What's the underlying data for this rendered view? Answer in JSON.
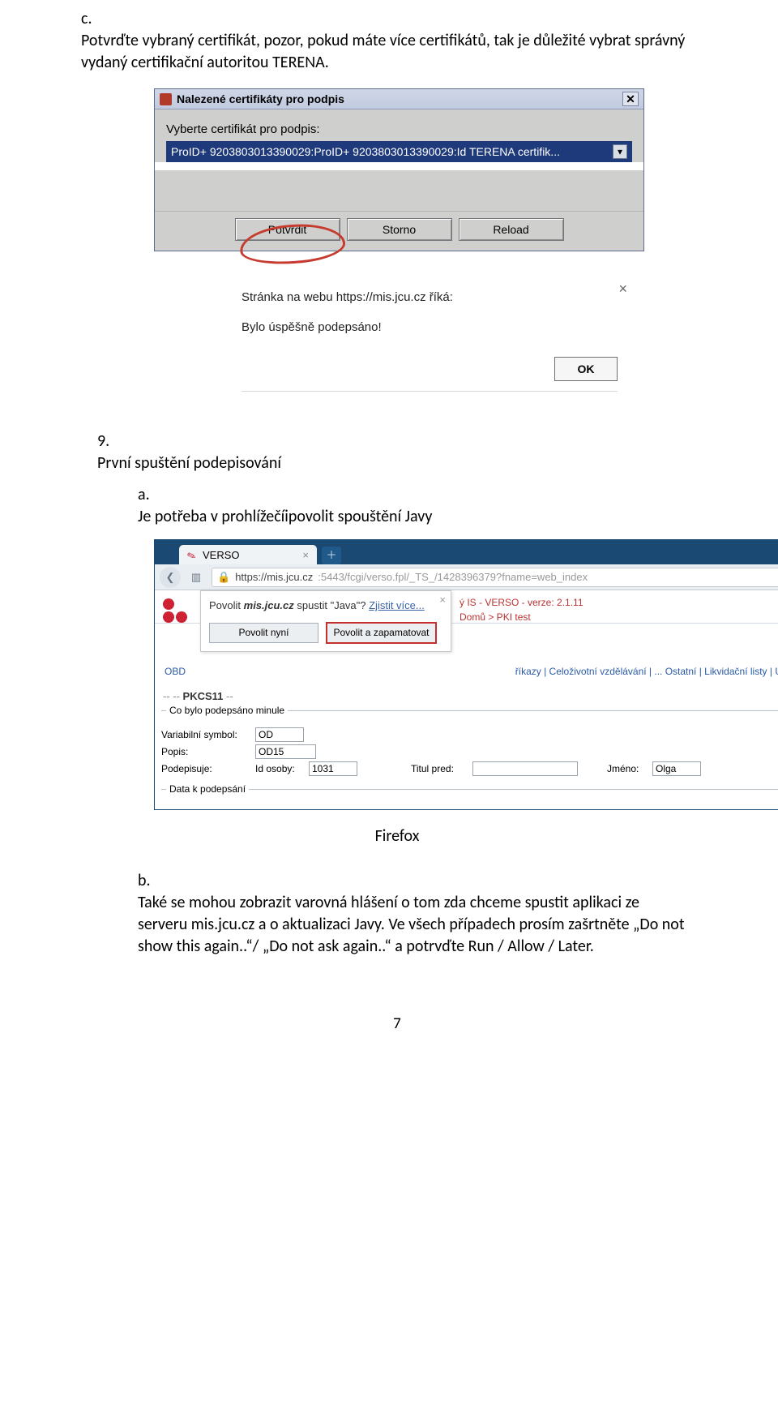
{
  "listC": {
    "marker": "c.",
    "text": "Potvrďte vybraný certifikát, pozor, pokud máte více certifikátů, tak je důležité vybrat správný vydaný certifikační autoritou TERENA."
  },
  "dlg1": {
    "title": "Nalezené certifikáty pro podpis",
    "label": "Vyberte certifikát pro podpis:",
    "selectText": "ProID+ 9203803013390029:ProID+ 9203803013390029:Id TERENA certifik...",
    "btns": {
      "confirm": "Potvrdit",
      "cancel": "Storno",
      "reload": "Reload"
    }
  },
  "dlg2": {
    "title": "Stránka na webu https://mis.jcu.cz říká:",
    "msg": "Bylo úspěšně podepsáno!",
    "ok": "OK"
  },
  "item9": {
    "marker": "9.",
    "text": "První spuštění podepisování"
  },
  "subA": {
    "marker": "a.",
    "text": "Je potřeba v prohlížečíipovolit spouštění Javy"
  },
  "ffx": {
    "tabTitle": "VERSO",
    "url": {
      "host": "https://mis.jcu.cz",
      "path": ":5443/fcgi/verso.fpl/_TS_/1428396379?fname=web_index"
    },
    "popup": {
      "pre": "Povolit ",
      "host": "mis.jcu.cz",
      "mid": " spustit \"Java\"? ",
      "link": "Zjistit více...",
      "btnNow": "Povolit nyní",
      "btnRemember": "Povolit a zapamatovat"
    },
    "versoSys": "ý IS - VERSO - verze: 2.1.11",
    "versoBread": "Domů > PKI test",
    "blueNavLeft": "OBD",
    "blueNavRight": "říkazy  |  Celoživotní vzdělávání  |  ... Ostatní  |  Likvidační listy  |  Ú",
    "pkcs": "PKCS11",
    "fs1Legend": "Co bylo podepsáno minule",
    "fields": {
      "varSym": "Variabilní symbol:",
      "varSymVal": "OD",
      "popis": "Popis:",
      "popisVal": "OD15",
      "podepisuje": "Podepisuje:",
      "idOsoby": "Id osoby:",
      "idOsobyVal": "1031",
      "titulPred": "Titul pred:",
      "titulPredVal": "",
      "jmeno": "Jméno:",
      "jmenoVal": "Olga"
    },
    "fs2Legend": "Data k podepsání"
  },
  "caption": "Firefox",
  "subB": {
    "marker": "b.",
    "text": "Také se mohou zobrazit varovná hlášení o tom zda chceme spustit aplikaci ze serveru mis.jcu.cz a o aktualizaci Javy. Ve všech případech prosím zašrtněte „Do not show this again..“/ „Do not ask again..“ a potrvďte Run / Allow / Later."
  },
  "pageNumber": "7"
}
